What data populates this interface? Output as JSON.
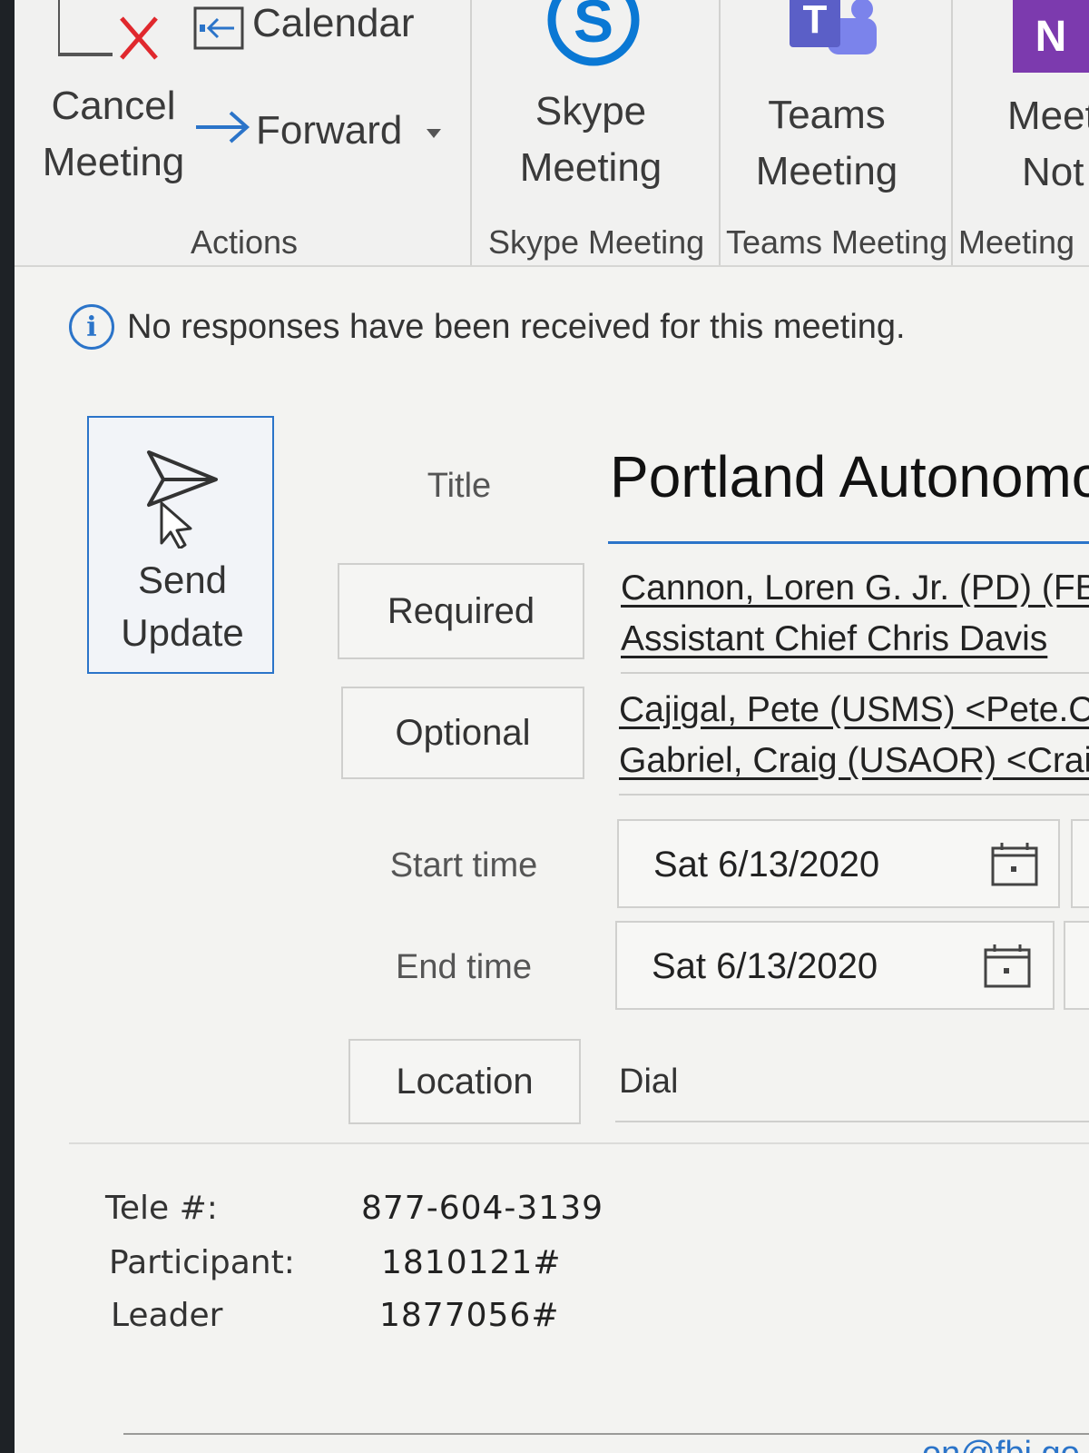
{
  "ribbon": {
    "actions": {
      "cancel_line1": "Cancel",
      "cancel_line2": "Meeting",
      "calendar": "Calendar",
      "forward": "Forward",
      "group_label": "Actions"
    },
    "skype": {
      "line1": "Skype",
      "line2": "Meeting",
      "group_label": "Skype Meeting"
    },
    "teams": {
      "line1": "Teams",
      "line2": "Meeting",
      "group_label": "Teams Meeting"
    },
    "meeting_notes": {
      "line1": "Meet",
      "line2": "Not",
      "group_label": "Meeting"
    }
  },
  "info_bar": {
    "icon": "info-icon",
    "message": "No responses have been received for this meeting."
  },
  "form": {
    "send_update": {
      "line1": "Send",
      "line2": "Update"
    },
    "title_label": "Title",
    "title_value": "Portland Autonomo",
    "required_label": "Required",
    "required_attendees": [
      "Cannon, Loren G. Jr. (PD) (FBI)",
      "Assistant Chief Chris Davis"
    ],
    "optional_label": "Optional",
    "optional_attendees": [
      "Cajigal, Pete (USMS) <Pete.Caji",
      "Gabriel, Craig (USAOR) <Craig.C"
    ],
    "start_label": "Start time",
    "start_date": "Sat 6/13/2020",
    "end_label": "End time",
    "end_date": "Sat 6/13/2020",
    "location_label": "Location",
    "location_value": "Dial"
  },
  "body": {
    "lines": [
      {
        "label": "Tele #:",
        "value": "877-604-3139"
      },
      {
        "label": "Participant:",
        "value": "1810121#"
      },
      {
        "label": "Leader",
        "value": "1877056#"
      }
    ],
    "cut_off_text": "on@fbi.go"
  },
  "colors": {
    "accent": "#2b74c9",
    "cancel_x": "#e0282d",
    "skype": "#0a78d4",
    "teams": "#5b5fc7",
    "onenote": "#7c3aae"
  }
}
